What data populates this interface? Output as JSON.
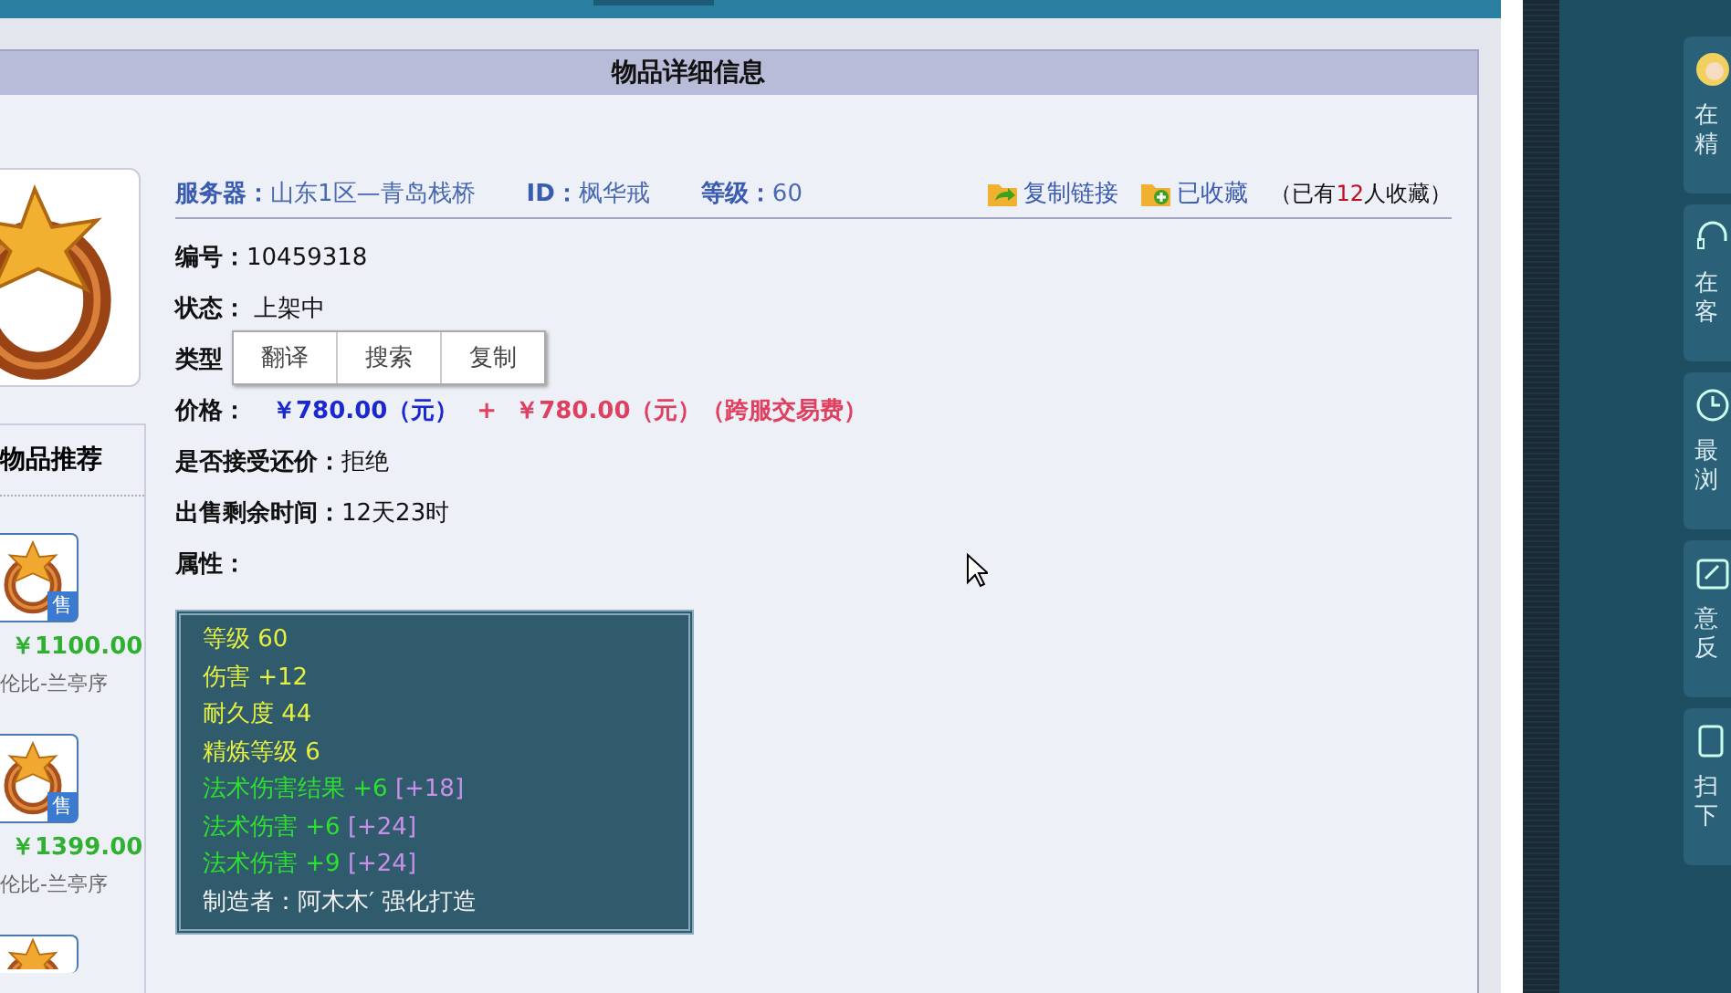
{
  "panel": {
    "title": "物品详细信息"
  },
  "summary": {
    "server_label": "服务器：",
    "server": "山东1区—青岛栈桥",
    "id_label": "ID：",
    "id": "枫华戒",
    "level_label": "等级：",
    "level": "60"
  },
  "actions": [
    {
      "label": "复制链接",
      "kind": "share"
    },
    {
      "label": "已收藏",
      "kind": "favorite"
    }
  ],
  "favorite_note": {
    "before": "（已有",
    "count": "12",
    "after": "人收藏）"
  },
  "fields": [
    {
      "kind": "text",
      "label": "编号：",
      "value": "10459318"
    },
    {
      "kind": "text",
      "label": "状态：",
      "value": " 上架中"
    },
    {
      "kind": "menu",
      "label": "类型",
      "menu": [
        "翻译",
        "搜索",
        "复制"
      ]
    },
    {
      "kind": "price",
      "label": "价格：",
      "price": "￥780.00（元）",
      "plus": "+",
      "fee": "￥780.00（元）（跨服交易费）"
    },
    {
      "kind": "text",
      "label": "是否接受还价：",
      "value": "拒绝"
    },
    {
      "kind": "text",
      "label": "出售剩余时间：",
      "value": "12天23时"
    },
    {
      "kind": "text",
      "label": "属性："
    }
  ],
  "attributes": [
    {
      "kind": "base",
      "text": "等级 60"
    },
    {
      "kind": "base",
      "text": "伤害 +12"
    },
    {
      "kind": "base",
      "text": "耐久度 44"
    },
    {
      "kind": "base",
      "text": "精炼等级 6"
    },
    {
      "kind": "magic",
      "text": "法术伤害结果 +6",
      "bonus": "[+18]"
    },
    {
      "kind": "magic",
      "text": "法术伤害 +6",
      "bonus": "[+24]"
    },
    {
      "kind": "magic",
      "text": "法术伤害 +9",
      "bonus": "[+24]"
    },
    {
      "kind": "maker",
      "text": "制造者：阿木木′ 强化打造"
    }
  ],
  "recommend": {
    "title": "物品推荐",
    "items": [
      {
        "kind": "full",
        "badge": "售",
        "price": "￥1100.00",
        "seller": "伦比-兰亭序"
      },
      {
        "kind": "full",
        "badge": "售",
        "price": "￥1399.00",
        "seller": "伦比-兰亭序"
      },
      {
        "kind": "cut"
      }
    ]
  },
  "side_panel": [
    {
      "kind": "avatar",
      "lines": [
        "在",
        "精"
      ]
    },
    {
      "kind": "headset",
      "lines": [
        "在",
        "客"
      ]
    },
    {
      "kind": "clock",
      "lines": [
        "最",
        "浏"
      ]
    },
    {
      "kind": "edit",
      "lines": [
        "意",
        "反"
      ]
    },
    {
      "kind": "phone",
      "lines": [
        "扫",
        "下"
      ]
    }
  ]
}
